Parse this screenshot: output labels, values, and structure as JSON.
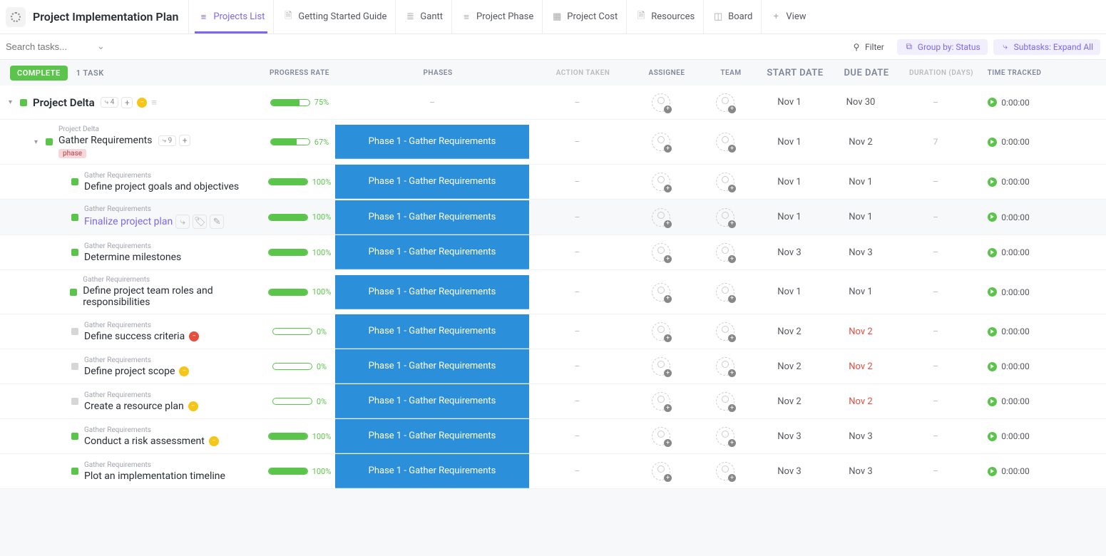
{
  "title": "Project Implementation Plan",
  "tabs": [
    {
      "label": "Projects List",
      "icon": "list",
      "active": true
    },
    {
      "label": "Getting Started Guide",
      "icon": "doc"
    },
    {
      "label": "Gantt",
      "icon": "gantt"
    },
    {
      "label": "Project Phase",
      "icon": "list"
    },
    {
      "label": "Project Cost",
      "icon": "table"
    },
    {
      "label": "Resources",
      "icon": "doc"
    },
    {
      "label": "Board",
      "icon": "board"
    },
    {
      "label": "View",
      "icon": "plus"
    }
  ],
  "search_placeholder": "Search tasks...",
  "filter_label": "Filter",
  "groupby_label": "Group by: Status",
  "subtasks_label": "Subtasks: Expand All",
  "status": {
    "badge": "COMPLETE",
    "count": "1 TASK"
  },
  "columns": {
    "progress": "PROGRESS RATE",
    "phases": "PHASES",
    "action": "ACTION TAKEN",
    "assignee": "ASSIGNEE",
    "team": "TEAM",
    "start": "START DATE",
    "due": "DUE DATE",
    "duration": "DURATION (DAYS)",
    "time": "TIME TRACKED"
  },
  "placeholder_dash": "–",
  "time_zero": "0:00:00",
  "phase1_label": "Phase 1 - Gather Requirements",
  "rows": [
    {
      "indent": 0,
      "caret": true,
      "sq": "green",
      "name": "Project Delta",
      "bold": true,
      "subchip": "4",
      "plus": true,
      "circle": "yellow",
      "bars": true,
      "progress": 75,
      "phase": "",
      "start": "Nov 1",
      "due": "Nov 30",
      "dur": "–"
    },
    {
      "indent": 1,
      "caret": true,
      "sq": "green",
      "parent": "Project Delta",
      "name": "Gather Requirements",
      "subchip": "9",
      "plus": true,
      "tag": "phase",
      "progress": 67,
      "phase": "1",
      "start": "Nov 1",
      "due": "Nov 2",
      "dur": "7"
    },
    {
      "indent": 2,
      "sq": "green",
      "parent": "Gather Requirements",
      "name": "Define project goals and objectives",
      "progress": 100,
      "phase": "1",
      "start": "Nov 1",
      "due": "Nov 1",
      "dur": "–"
    },
    {
      "indent": 2,
      "sq": "green",
      "parent": "Gather Requirements",
      "hover": true,
      "name": "Finalize project plan",
      "purple": true,
      "icons": true,
      "progress": 100,
      "phase": "1",
      "start": "Nov 1",
      "due": "Nov 1",
      "dur": "–"
    },
    {
      "indent": 2,
      "sq": "green",
      "parent": "Gather Requirements",
      "name": "Determine milestones",
      "progress": 100,
      "phase": "1",
      "start": "Nov 3",
      "due": "Nov 3",
      "dur": "–"
    },
    {
      "indent": 2,
      "sq": "green",
      "parent": "Gather Requirements",
      "name": "Define project team roles and responsibilities",
      "progress": 100,
      "phase": "1",
      "start": "Nov 1",
      "due": "Nov 1",
      "dur": "–"
    },
    {
      "indent": 2,
      "sq": "grey",
      "parent": "Gather Requirements",
      "name": "Define success criteria",
      "circle": "red",
      "progress": 0,
      "phase": "1",
      "start": "Nov 2",
      "due": "Nov 2",
      "due_red": true,
      "dur": "–"
    },
    {
      "indent": 2,
      "sq": "grey",
      "parent": "Gather Requirements",
      "name": "Define project scope",
      "circle": "yellow",
      "progress": 0,
      "phase": "1",
      "start": "Nov 2",
      "due": "Nov 2",
      "due_red": true,
      "dur": "–"
    },
    {
      "indent": 2,
      "sq": "grey",
      "parent": "Gather Requirements",
      "name": "Create a resource plan",
      "circle": "yellow",
      "progress": 0,
      "phase": "1",
      "start": "Nov 2",
      "due": "Nov 2",
      "due_red": true,
      "dur": "–"
    },
    {
      "indent": 2,
      "sq": "green",
      "parent": "Gather Requirements",
      "name": "Conduct a risk assessment",
      "circle": "yellow",
      "progress": 100,
      "phase": "1",
      "start": "Nov 3",
      "due": "Nov 3",
      "dur": "–"
    },
    {
      "indent": 2,
      "sq": "green",
      "parent": "Gather Requirements",
      "name": "Plot an implementation timeline",
      "progress": 100,
      "phase": "1",
      "start": "Nov 3",
      "due": "Nov 3",
      "dur": "–"
    }
  ]
}
